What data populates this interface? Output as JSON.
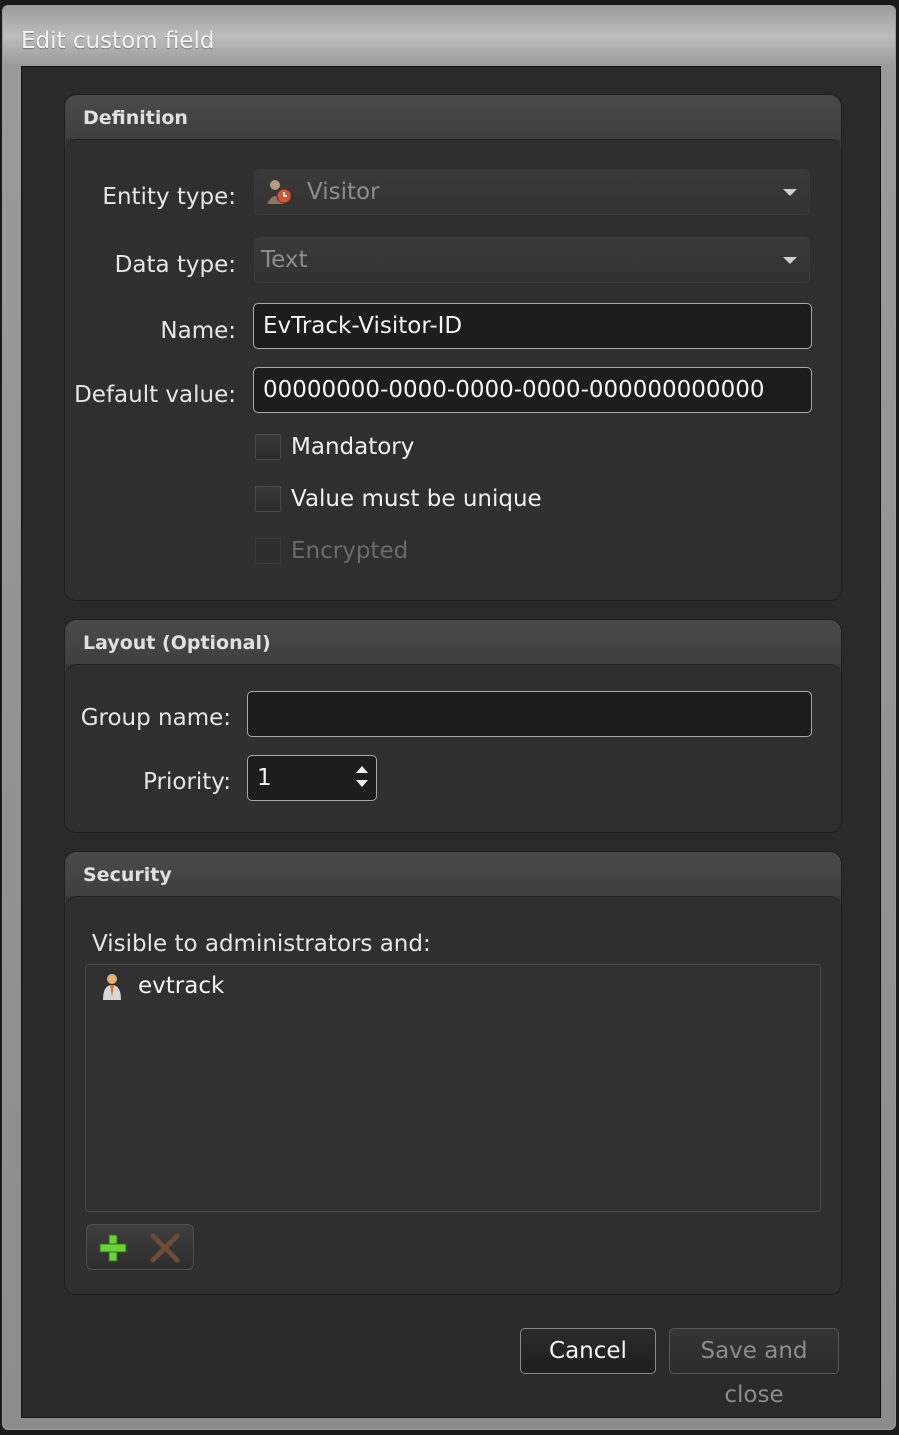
{
  "window": {
    "title": "Edit custom field"
  },
  "definition": {
    "title": "Definition",
    "entity_type_label": "Entity type:",
    "entity_type_value": "Visitor",
    "data_type_label": "Data type:",
    "data_type_value": "Text",
    "name_label": "Name:",
    "name_value": "EvTrack-Visitor-ID",
    "default_value_label": "Default value:",
    "default_value_value": "00000000-0000-0000-0000-000000000000",
    "checkboxes": [
      {
        "label": "Mandatory",
        "checked": false,
        "enabled": true
      },
      {
        "label": "Value must be unique",
        "checked": false,
        "enabled": true
      },
      {
        "label": "Encrypted",
        "checked": false,
        "enabled": false
      }
    ]
  },
  "layout": {
    "title": "Layout (Optional)",
    "group_name_label": "Group name:",
    "group_name_value": "",
    "priority_label": "Priority:",
    "priority_value": "1"
  },
  "security": {
    "title": "Security",
    "visible_label": "Visible to administrators and:",
    "users": [
      {
        "name": "evtrack",
        "icon": "user-icon"
      }
    ],
    "add_icon": "plus-icon",
    "remove_icon": "x-icon"
  },
  "footer": {
    "cancel_label": "Cancel",
    "save_label": "Save and close"
  }
}
